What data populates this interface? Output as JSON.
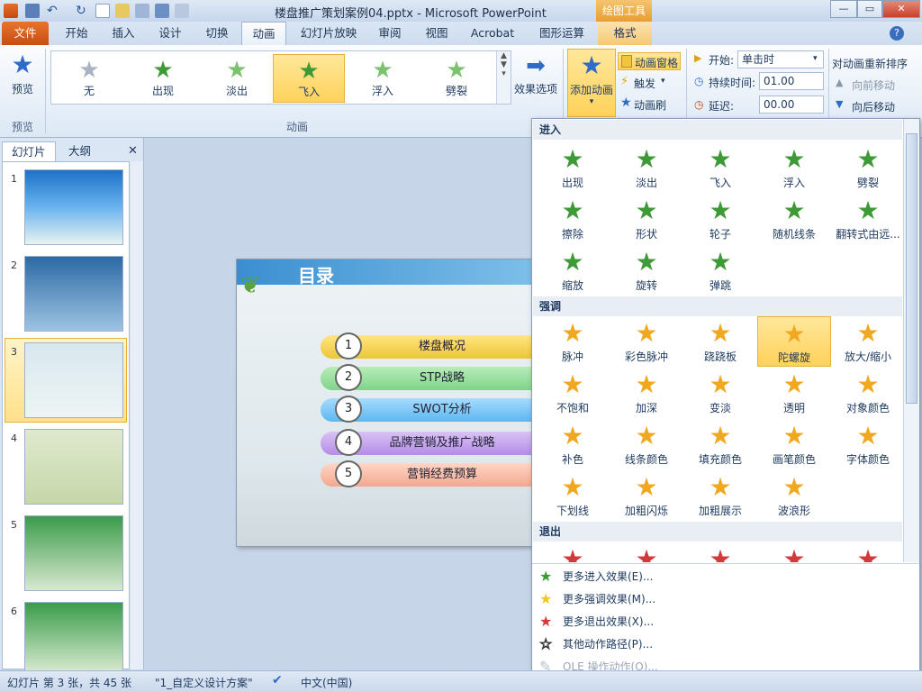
{
  "window": {
    "title": "楼盘推广策划案例04.pptx - Microsoft PowerPoint",
    "contextual_group": "绘图工具",
    "buttons": {
      "help": "?",
      "minimize": "—",
      "restore": "▭",
      "close": "✕"
    }
  },
  "tabs": [
    "文件",
    "开始",
    "插入",
    "设计",
    "切换",
    "动画",
    "幻灯片放映",
    "审阅",
    "视图",
    "Acrobat",
    "图形运算",
    "格式"
  ],
  "ribbon": {
    "preview": {
      "label": "预览",
      "group": "预览"
    },
    "animation_group": "动画",
    "gallery": [
      "无",
      "出现",
      "淡出",
      "飞入",
      "浮入",
      "劈裂"
    ],
    "effect_options": "效果选项",
    "add_animation": "添加动画",
    "animation_pane": "动画窗格",
    "trigger": "触发",
    "anim_painter": "动画刷",
    "start_label": "开始:",
    "start_value": "单击时",
    "duration_label": "持续时间:",
    "duration_value": "01.00",
    "delay_label": "延迟:",
    "delay_value": "00.00",
    "reorder_label": "对动画重新排序",
    "move_earlier": "向前移动",
    "move_later": "向后移动"
  },
  "left_pane": {
    "tab_slides": "幻灯片",
    "tab_outline": "大纲",
    "close": "✕",
    "slides": [
      "1",
      "2",
      "3",
      "4",
      "5",
      "6"
    ],
    "active_slide": 3
  },
  "slide": {
    "title": "目录",
    "items": [
      {
        "n": "1",
        "text": "楼盘概况"
      },
      {
        "n": "2",
        "text": "STP战略"
      },
      {
        "n": "3",
        "text": "SWOT分析"
      },
      {
        "n": "4",
        "text": "品牌营销及推广战略"
      },
      {
        "n": "5",
        "text": "营销经费预算"
      }
    ]
  },
  "dropdown": {
    "entrance_header": "进入",
    "entrance": [
      "出现",
      "淡出",
      "飞入",
      "浮入",
      "劈裂",
      "擦除",
      "形状",
      "轮子",
      "随机线条",
      "翻转式由远...",
      "缩放",
      "旋转",
      "弹跳"
    ],
    "emphasis_header": "强调",
    "emphasis": [
      "脉冲",
      "彩色脉冲",
      "跷跷板",
      "陀螺旋",
      "放大/缩小",
      "不饱和",
      "加深",
      "变淡",
      "透明",
      "对象颜色",
      "补色",
      "线条颜色",
      "填充颜色",
      "画笔颜色",
      "字体颜色",
      "下划线",
      "加粗闪烁",
      "加粗展示",
      "波浪形"
    ],
    "exit_header": "退出",
    "more": [
      "更多进入效果(E)...",
      "更多强调效果(M)...",
      "更多退出效果(X)...",
      "其他动作路径(P)...",
      "OLE 操作动作(O)..."
    ]
  },
  "statusbar": {
    "slide_info": "幻灯片 第 3 张，共 45 张",
    "theme": "\"1_自定义设计方案\"",
    "language": "中文(中国)"
  },
  "colors": {
    "accent": "#f0b232",
    "file_tab": "#d9621f",
    "entrance": "#3e9a36",
    "emphasis": "#f0a820",
    "exit": "#d23a3a"
  }
}
